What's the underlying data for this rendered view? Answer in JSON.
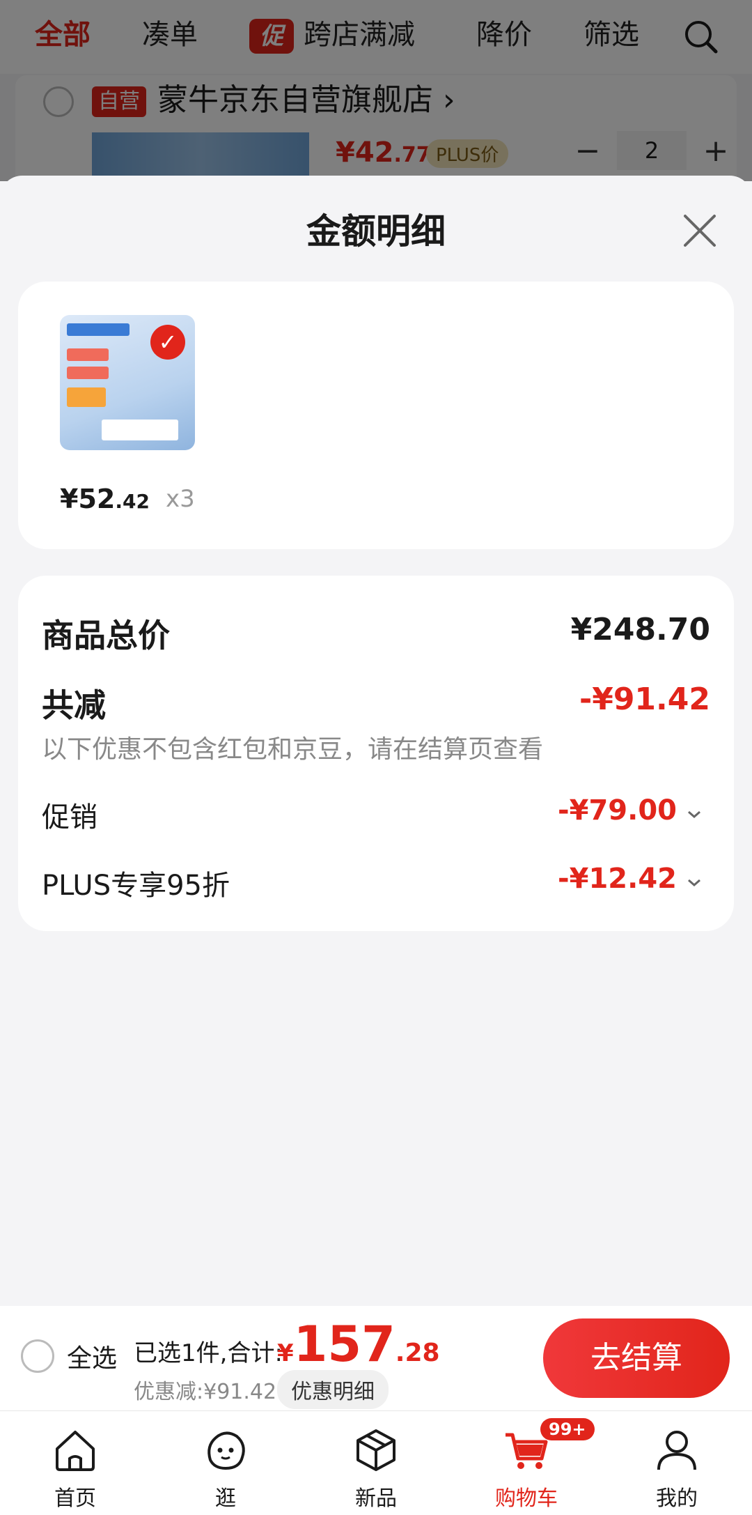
{
  "top_tabs": [
    "全部",
    "凑单",
    "跨店满减",
    "降价",
    "筛选"
  ],
  "promo_badge": "促",
  "store": {
    "self_operated_badge": "自营",
    "name": "蒙牛京东自营旗舰店",
    "price_symbol": "¥",
    "price_main": "42",
    "price_decimal": ".77",
    "plus_tag": "PLUS价",
    "quantity": "2",
    "minus": "−",
    "plus": "+"
  },
  "sheet": {
    "title": "金额明细",
    "item": {
      "price_main": "¥52",
      "price_decimal": ".42",
      "quantity": "x3"
    },
    "total_label": "商品总价",
    "total_value": "¥248.70",
    "reduced_label": "共减",
    "reduced_value": "-¥91.42",
    "note": "以下优惠不包含红包和京豆，请在结算页查看",
    "lines": [
      {
        "label": "促销",
        "value": "-¥79.00"
      },
      {
        "label": "PLUS专享95折",
        "value": "-¥12.42"
      }
    ]
  },
  "checkout": {
    "select_all": "全选",
    "selected_text": "已选1件,合计:",
    "total_symbol": "¥",
    "total_main": "157",
    "total_decimal": ".28",
    "discount_text": "优惠减:¥91.42",
    "detail_button": "优惠明细",
    "checkout_button": "去结算"
  },
  "nav": [
    {
      "label": "首页",
      "icon": "home-icon"
    },
    {
      "label": "逛",
      "icon": "browse-icon"
    },
    {
      "label": "新品",
      "icon": "new-products-icon"
    },
    {
      "label": "购物车",
      "icon": "cart-icon",
      "badge": "99+",
      "active": true
    },
    {
      "label": "我的",
      "icon": "profile-icon"
    }
  ],
  "colors": {
    "accent": "#e1251b",
    "background": "#f4f4f6"
  }
}
